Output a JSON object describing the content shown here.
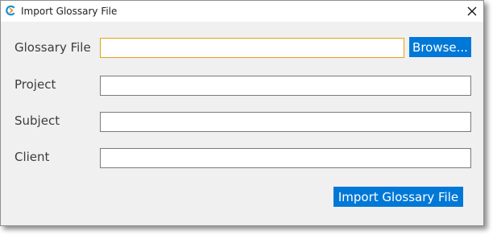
{
  "window": {
    "title": "Import Glossary File"
  },
  "form": {
    "glossary_file": {
      "label": "Glossary File",
      "value": "",
      "browse_label": "Browse..."
    },
    "project": {
      "label": "Project",
      "value": ""
    },
    "subject": {
      "label": "Subject",
      "value": ""
    },
    "client": {
      "label": "Client",
      "value": ""
    }
  },
  "actions": {
    "import_label": "Import Glossary File"
  },
  "colors": {
    "accent": "#0078d7",
    "focus_border": "#e3a21a",
    "dialog_background": "#f0f0f0"
  }
}
